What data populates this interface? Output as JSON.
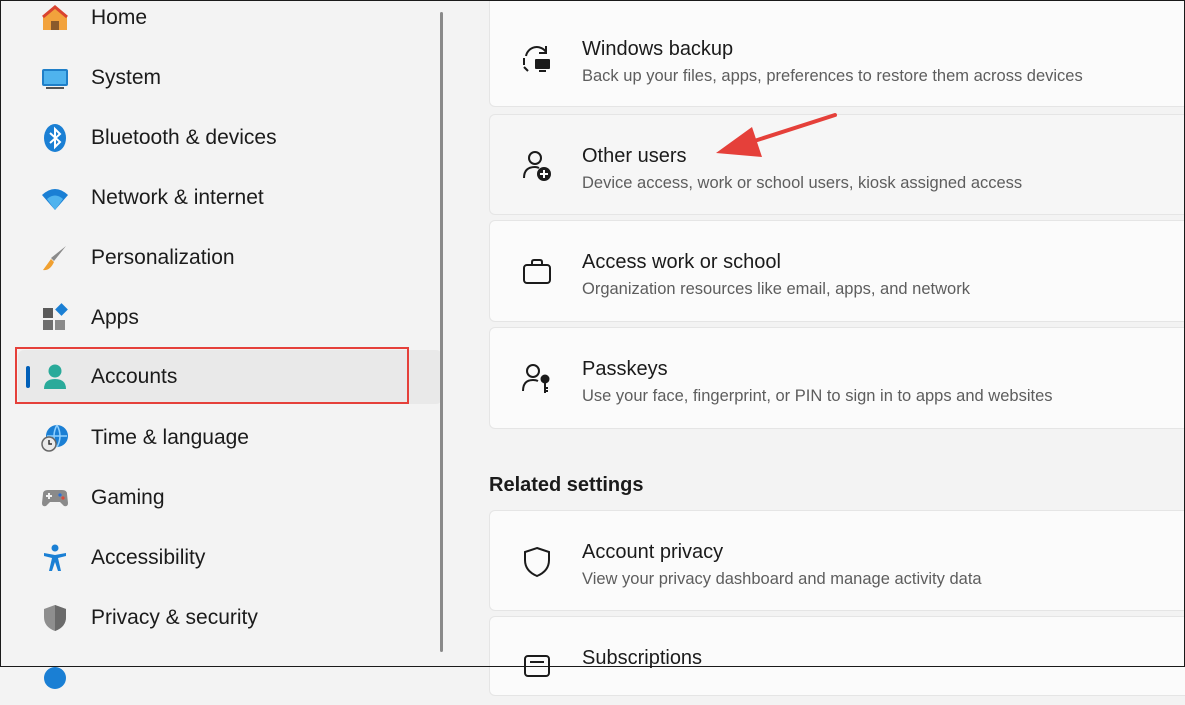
{
  "sidebar": {
    "items": [
      {
        "label": "Home",
        "icon": "home-icon"
      },
      {
        "label": "System",
        "icon": "system-icon"
      },
      {
        "label": "Bluetooth & devices",
        "icon": "bluetooth-icon"
      },
      {
        "label": "Network & internet",
        "icon": "wifi-icon"
      },
      {
        "label": "Personalization",
        "icon": "brush-icon"
      },
      {
        "label": "Apps",
        "icon": "apps-icon"
      },
      {
        "label": "Accounts",
        "icon": "accounts-icon",
        "selected": true
      },
      {
        "label": "Time & language",
        "icon": "globe-clock-icon"
      },
      {
        "label": "Gaming",
        "icon": "gamepad-icon"
      },
      {
        "label": "Accessibility",
        "icon": "accessibility-icon"
      },
      {
        "label": "Privacy & security",
        "icon": "shield-icon"
      }
    ]
  },
  "main": {
    "cards": [
      {
        "title": "Windows backup",
        "desc": "Back up your files, apps, preferences to restore them across devices",
        "icon": "backup-icon"
      },
      {
        "title": "Other users",
        "desc": "Device access, work or school users, kiosk assigned access",
        "icon": "add-user-icon"
      },
      {
        "title": "Access work or school",
        "desc": "Organization resources like email, apps, and network",
        "icon": "briefcase-icon"
      },
      {
        "title": "Passkeys",
        "desc": "Use your face, fingerprint, or PIN to sign in to apps and websites",
        "icon": "passkey-icon"
      }
    ],
    "related_title": "Related settings",
    "related_cards": [
      {
        "title": "Account privacy",
        "desc": "View your privacy dashboard and manage activity data",
        "icon": "privacy-shield-icon"
      },
      {
        "title": "Subscriptions",
        "desc": "",
        "icon": "subscriptions-icon"
      }
    ]
  },
  "colors": {
    "accent": "#005fb8",
    "annotation": "#e5403a"
  }
}
